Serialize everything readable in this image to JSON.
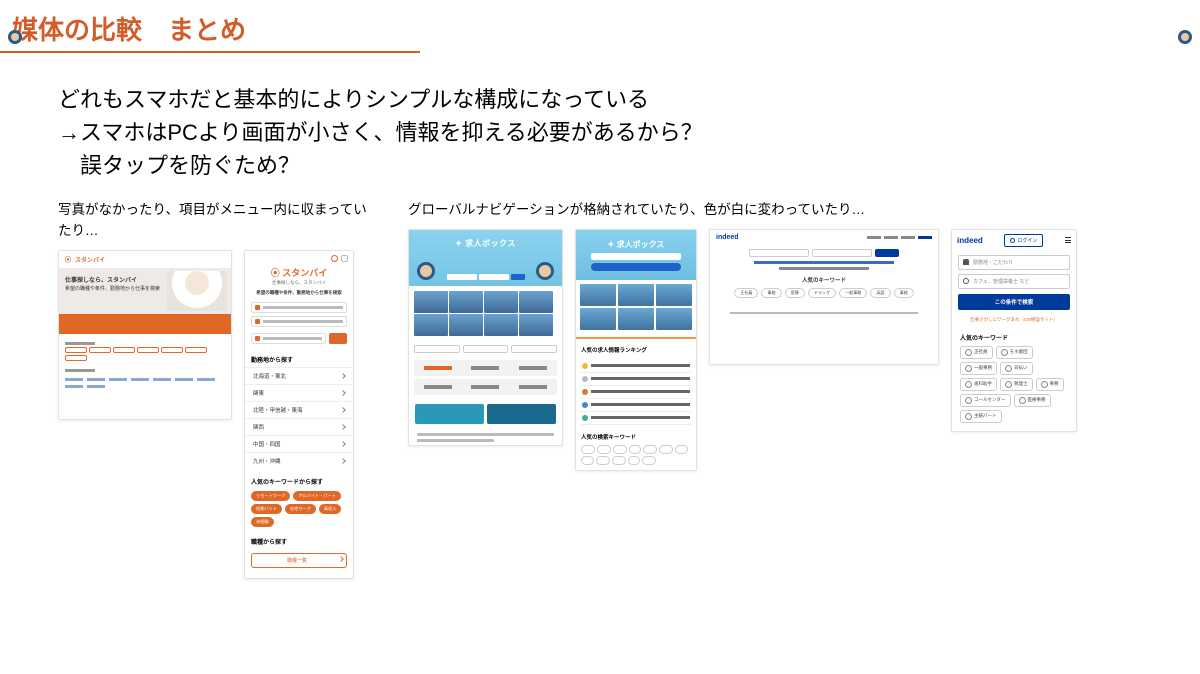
{
  "title": "媒体の比較　まとめ",
  "lead": {
    "l1": "どれもスマホだと基本的によりシンプルな構成になっている",
    "l2": "→スマホはPCより画面が小さく、情報を抑える必要があるから？",
    "l3": "　誤タップを防ぐため？"
  },
  "left": {
    "caption": "写真がなかったり、項目がメニュー内に収まっていたり…",
    "stanby": {
      "brand": "スタンバイ",
      "hero_copy_b": "仕事探しなら、スタンバイ",
      "hero_copy": "希望の職種や条件、勤務地から仕事を検索",
      "region_h": "勤務地から探す",
      "regions": [
        "北海道・東北",
        "関東",
        "北陸・甲信越・東海",
        "関西",
        "中国・四国",
        "九州・沖縄"
      ],
      "kw_h": "人気のキーワードから探す",
      "kw": [
        "リモートワーク",
        "アルバイト・パート",
        "短期バイト",
        "在宅ワーク",
        "高収入",
        "未経験"
      ],
      "job_h": "職種から探す",
      "job_btn": "職種一覧"
    }
  },
  "right": {
    "caption": "グローバルナビゲーションが格納されていたり、色が白に変わっていたり…",
    "kyujin": {
      "brand": "求人ボックス",
      "pop_h": "人気の求人情報ランキング"
    },
    "indeed": {
      "brand": "indeed",
      "login": "ログイン",
      "f1": "勤務地・こだわり",
      "f2": "カフェ、管理栄養士 など",
      "submit": "この条件で検索",
      "note": "仕事さがしにワーグあれ（CM特設サイト）",
      "kw_h": "人気のキーワード",
      "kw_list": [
        "正社員",
        "モネ劇団",
        "一般事務",
        "日払い",
        "歯科助手",
        "税理士",
        "事務",
        "コールセンター",
        "医療事務",
        "主婦パート"
      ],
      "desktop_kw_h": "人気のキーワード"
    }
  }
}
